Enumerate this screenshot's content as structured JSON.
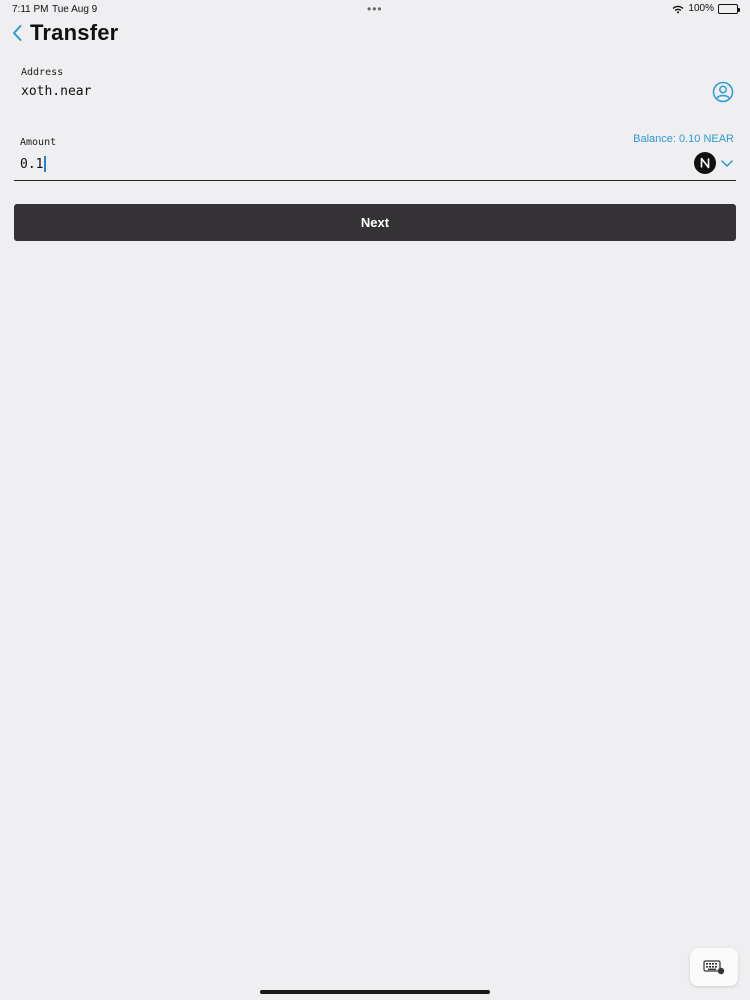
{
  "status_bar": {
    "time": "7:11 PM",
    "date": "Tue Aug 9",
    "dots": "•••",
    "battery": "100%"
  },
  "header": {
    "title": "Transfer",
    "back_icon": "chevron-left-icon"
  },
  "address_field": {
    "label": "Address",
    "value": "xoth.near",
    "icon": "contact-icon"
  },
  "amount_field": {
    "label": "Amount",
    "value": "0.1",
    "balance": "Balance: 0.10 NEAR",
    "token_icon": "near-logo",
    "dropdown_icon": "chevron-down-icon"
  },
  "next_button": {
    "label": "Next"
  },
  "colors": {
    "background": "#efeef1",
    "accent": "#2b9bd4",
    "button": "#343234"
  }
}
